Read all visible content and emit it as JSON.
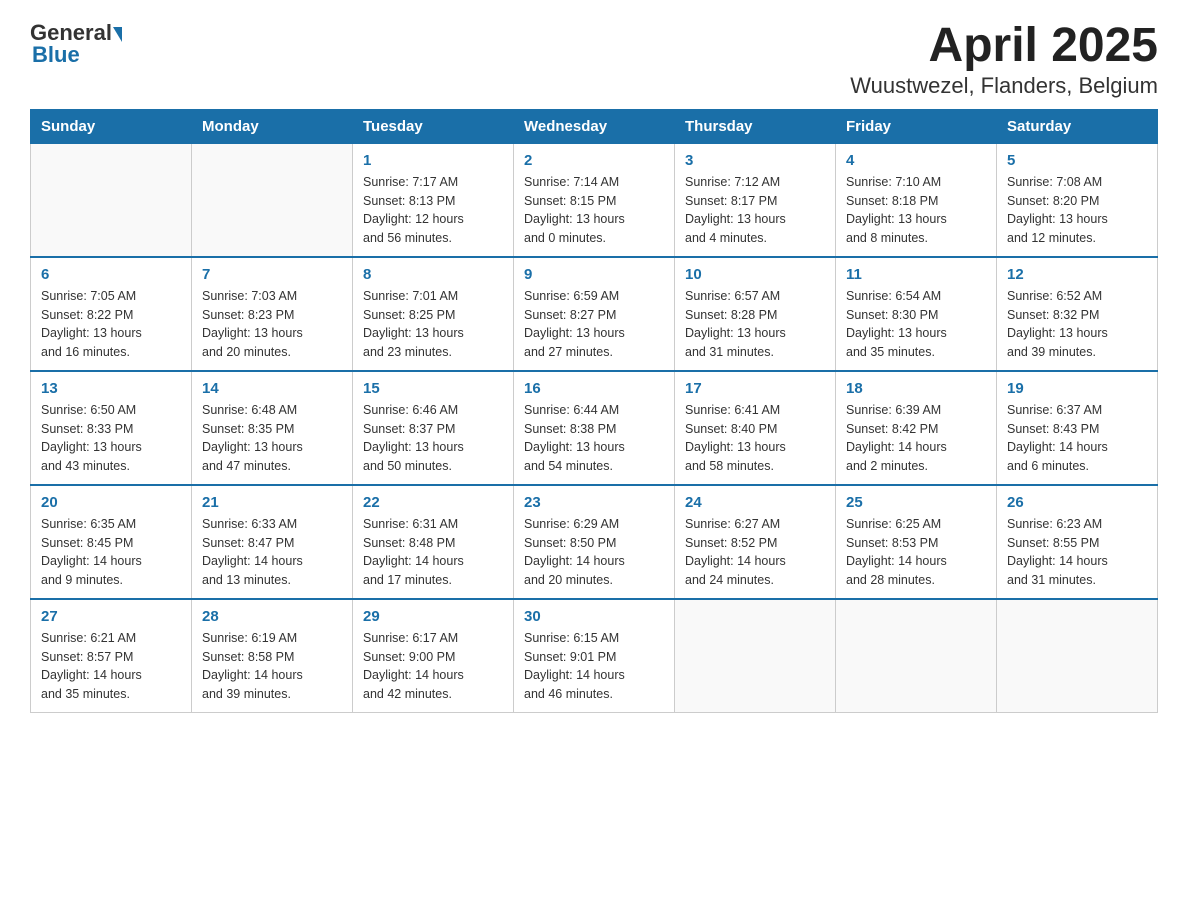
{
  "header": {
    "logo_general": "General",
    "logo_blue": "Blue",
    "title": "April 2025",
    "subtitle": "Wuustwezel, Flanders, Belgium"
  },
  "days_of_week": [
    "Sunday",
    "Monday",
    "Tuesday",
    "Wednesday",
    "Thursday",
    "Friday",
    "Saturday"
  ],
  "weeks": [
    [
      {
        "day": "",
        "info": ""
      },
      {
        "day": "",
        "info": ""
      },
      {
        "day": "1",
        "info": "Sunrise: 7:17 AM\nSunset: 8:13 PM\nDaylight: 12 hours\nand 56 minutes."
      },
      {
        "day": "2",
        "info": "Sunrise: 7:14 AM\nSunset: 8:15 PM\nDaylight: 13 hours\nand 0 minutes."
      },
      {
        "day": "3",
        "info": "Sunrise: 7:12 AM\nSunset: 8:17 PM\nDaylight: 13 hours\nand 4 minutes."
      },
      {
        "day": "4",
        "info": "Sunrise: 7:10 AM\nSunset: 8:18 PM\nDaylight: 13 hours\nand 8 minutes."
      },
      {
        "day": "5",
        "info": "Sunrise: 7:08 AM\nSunset: 8:20 PM\nDaylight: 13 hours\nand 12 minutes."
      }
    ],
    [
      {
        "day": "6",
        "info": "Sunrise: 7:05 AM\nSunset: 8:22 PM\nDaylight: 13 hours\nand 16 minutes."
      },
      {
        "day": "7",
        "info": "Sunrise: 7:03 AM\nSunset: 8:23 PM\nDaylight: 13 hours\nand 20 minutes."
      },
      {
        "day": "8",
        "info": "Sunrise: 7:01 AM\nSunset: 8:25 PM\nDaylight: 13 hours\nand 23 minutes."
      },
      {
        "day": "9",
        "info": "Sunrise: 6:59 AM\nSunset: 8:27 PM\nDaylight: 13 hours\nand 27 minutes."
      },
      {
        "day": "10",
        "info": "Sunrise: 6:57 AM\nSunset: 8:28 PM\nDaylight: 13 hours\nand 31 minutes."
      },
      {
        "day": "11",
        "info": "Sunrise: 6:54 AM\nSunset: 8:30 PM\nDaylight: 13 hours\nand 35 minutes."
      },
      {
        "day": "12",
        "info": "Sunrise: 6:52 AM\nSunset: 8:32 PM\nDaylight: 13 hours\nand 39 minutes."
      }
    ],
    [
      {
        "day": "13",
        "info": "Sunrise: 6:50 AM\nSunset: 8:33 PM\nDaylight: 13 hours\nand 43 minutes."
      },
      {
        "day": "14",
        "info": "Sunrise: 6:48 AM\nSunset: 8:35 PM\nDaylight: 13 hours\nand 47 minutes."
      },
      {
        "day": "15",
        "info": "Sunrise: 6:46 AM\nSunset: 8:37 PM\nDaylight: 13 hours\nand 50 minutes."
      },
      {
        "day": "16",
        "info": "Sunrise: 6:44 AM\nSunset: 8:38 PM\nDaylight: 13 hours\nand 54 minutes."
      },
      {
        "day": "17",
        "info": "Sunrise: 6:41 AM\nSunset: 8:40 PM\nDaylight: 13 hours\nand 58 minutes."
      },
      {
        "day": "18",
        "info": "Sunrise: 6:39 AM\nSunset: 8:42 PM\nDaylight: 14 hours\nand 2 minutes."
      },
      {
        "day": "19",
        "info": "Sunrise: 6:37 AM\nSunset: 8:43 PM\nDaylight: 14 hours\nand 6 minutes."
      }
    ],
    [
      {
        "day": "20",
        "info": "Sunrise: 6:35 AM\nSunset: 8:45 PM\nDaylight: 14 hours\nand 9 minutes."
      },
      {
        "day": "21",
        "info": "Sunrise: 6:33 AM\nSunset: 8:47 PM\nDaylight: 14 hours\nand 13 minutes."
      },
      {
        "day": "22",
        "info": "Sunrise: 6:31 AM\nSunset: 8:48 PM\nDaylight: 14 hours\nand 17 minutes."
      },
      {
        "day": "23",
        "info": "Sunrise: 6:29 AM\nSunset: 8:50 PM\nDaylight: 14 hours\nand 20 minutes."
      },
      {
        "day": "24",
        "info": "Sunrise: 6:27 AM\nSunset: 8:52 PM\nDaylight: 14 hours\nand 24 minutes."
      },
      {
        "day": "25",
        "info": "Sunrise: 6:25 AM\nSunset: 8:53 PM\nDaylight: 14 hours\nand 28 minutes."
      },
      {
        "day": "26",
        "info": "Sunrise: 6:23 AM\nSunset: 8:55 PM\nDaylight: 14 hours\nand 31 minutes."
      }
    ],
    [
      {
        "day": "27",
        "info": "Sunrise: 6:21 AM\nSunset: 8:57 PM\nDaylight: 14 hours\nand 35 minutes."
      },
      {
        "day": "28",
        "info": "Sunrise: 6:19 AM\nSunset: 8:58 PM\nDaylight: 14 hours\nand 39 minutes."
      },
      {
        "day": "29",
        "info": "Sunrise: 6:17 AM\nSunset: 9:00 PM\nDaylight: 14 hours\nand 42 minutes."
      },
      {
        "day": "30",
        "info": "Sunrise: 6:15 AM\nSunset: 9:01 PM\nDaylight: 14 hours\nand 46 minutes."
      },
      {
        "day": "",
        "info": ""
      },
      {
        "day": "",
        "info": ""
      },
      {
        "day": "",
        "info": ""
      }
    ]
  ]
}
